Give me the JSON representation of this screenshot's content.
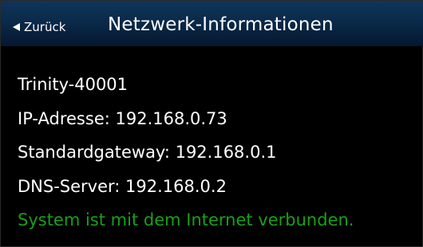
{
  "header": {
    "back_label": "Zurück",
    "title": "Netzwerk-Informationen"
  },
  "network_info": {
    "device_name": "Trinity-40001",
    "ip_address": "IP-Adresse: 192.168.0.73",
    "gateway": "Standardgateway: 192.168.0.1",
    "dns_server": "DNS-Server: 192.168.0.2",
    "status": "System ist mit dem Internet verbunden."
  },
  "colors": {
    "header_bg": "#0a2a4a",
    "status_ok": "#18a018",
    "text": "#ffffff",
    "background": "#000000"
  }
}
